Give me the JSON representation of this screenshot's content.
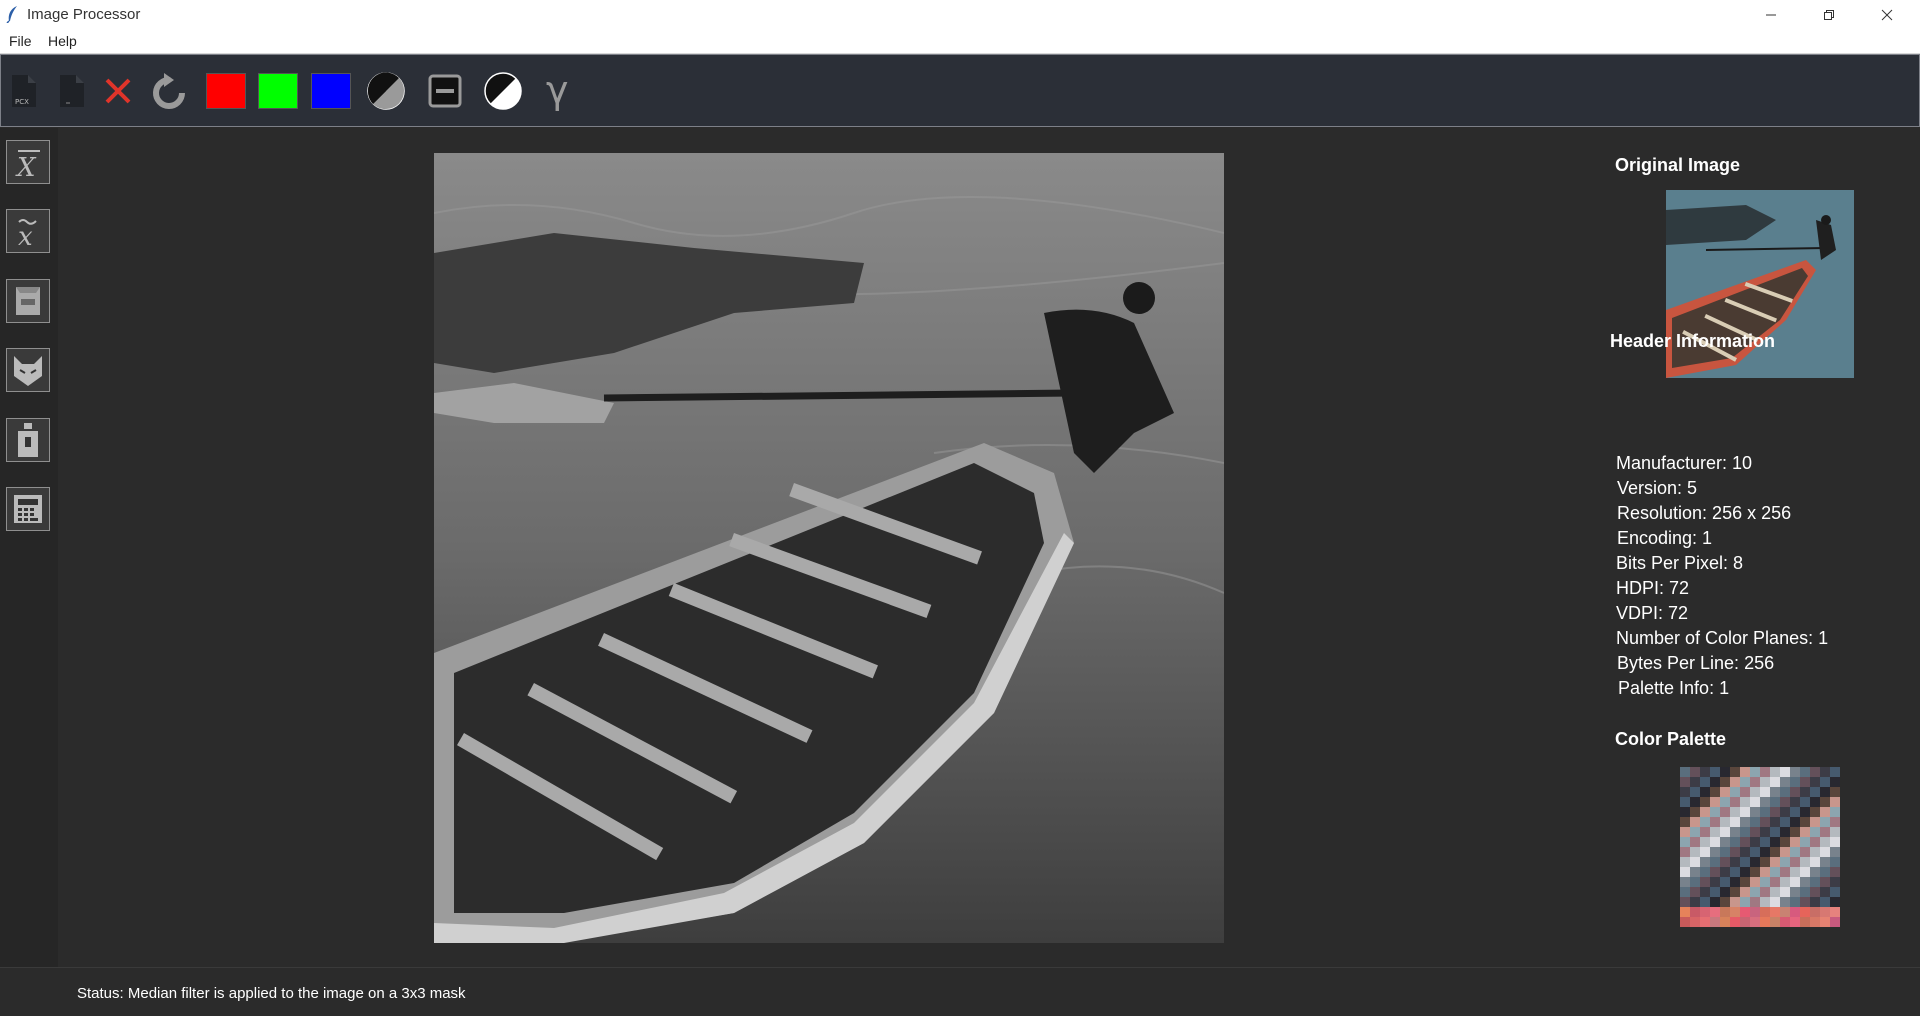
{
  "window": {
    "title": "Image Processor"
  },
  "menu": {
    "items": [
      "File",
      "Help"
    ]
  },
  "toolbar": {
    "tools": [
      {
        "name": "open-pcx-icon",
        "label": "PCX"
      },
      {
        "name": "new-file-icon",
        "label": ""
      },
      {
        "name": "close-image-icon",
        "label": ""
      },
      {
        "name": "reset-icon",
        "label": ""
      },
      {
        "name": "red-channel-button",
        "color": "#ff0000"
      },
      {
        "name": "green-channel-button",
        "color": "#00ff00"
      },
      {
        "name": "blue-channel-button",
        "color": "#0000ff"
      },
      {
        "name": "grayscale-icon",
        "label": ""
      },
      {
        "name": "threshold-icon",
        "label": ""
      },
      {
        "name": "negative-icon",
        "label": ""
      },
      {
        "name": "gamma-icon",
        "label": "γ"
      }
    ]
  },
  "left_tools": [
    {
      "name": "mean-filter-icon",
      "symbol": "X̄"
    },
    {
      "name": "median-filter-icon",
      "symbol": "x̃"
    },
    {
      "name": "laplacian-icon"
    },
    {
      "name": "cat-icon"
    },
    {
      "name": "bottle-icon"
    },
    {
      "name": "calculator-icon"
    }
  ],
  "right_panel": {
    "original_title": "Original Image",
    "header_title": "Header Information",
    "palette_title": "Color Palette",
    "header_lines": [
      "Manufacturer: 10",
      "Version: 5",
      "Resolution: 256 x 256",
      "Encoding: 1",
      "Bits Per Pixel: 8",
      "HDPI: 72",
      "VDPI: 72",
      "Number of Color Planes: 1",
      "Bytes Per Line: 256",
      "Palette Info: 1"
    ]
  },
  "status": {
    "text": "Status: Median filter is applied to the image on a 3x3 mask"
  }
}
